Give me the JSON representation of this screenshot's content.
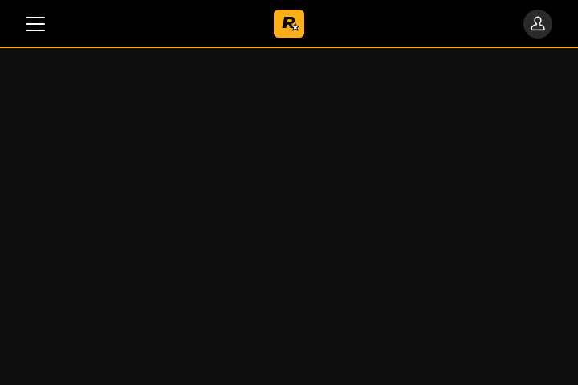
{
  "colors": {
    "header_background": "#000000",
    "accent": "#fcaf17",
    "page_background": "#0e0e0f",
    "profile_button_background": "#2a2a2c",
    "icon": "#ffffff"
  },
  "header": {
    "menu_icon": "hamburger-menu-icon",
    "logo_icon": "rockstar-games-logo",
    "profile_icon": "user-profile-icon"
  }
}
